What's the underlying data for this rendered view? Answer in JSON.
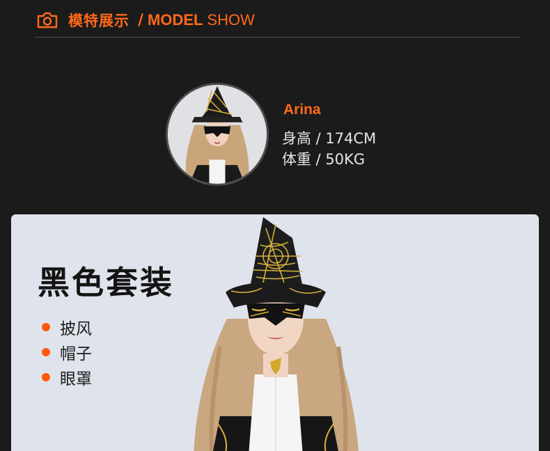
{
  "header": {
    "title_cn": "模特展示",
    "slash": "/",
    "title_en_bold": "MODEL",
    "title_en_light": "SHOW",
    "icon": "camera-icon"
  },
  "model": {
    "name": "Arina",
    "height": "身高 / 174CM",
    "weight": "体重 / 50KG"
  },
  "product": {
    "title": "黑色套装",
    "items": [
      "披风",
      "帽子",
      "眼罩"
    ]
  },
  "colors": {
    "accent": "#ff6a1a",
    "background": "#1b1b1b",
    "card_background": "#dfe3ec",
    "bullet": "#ff5a0a"
  }
}
